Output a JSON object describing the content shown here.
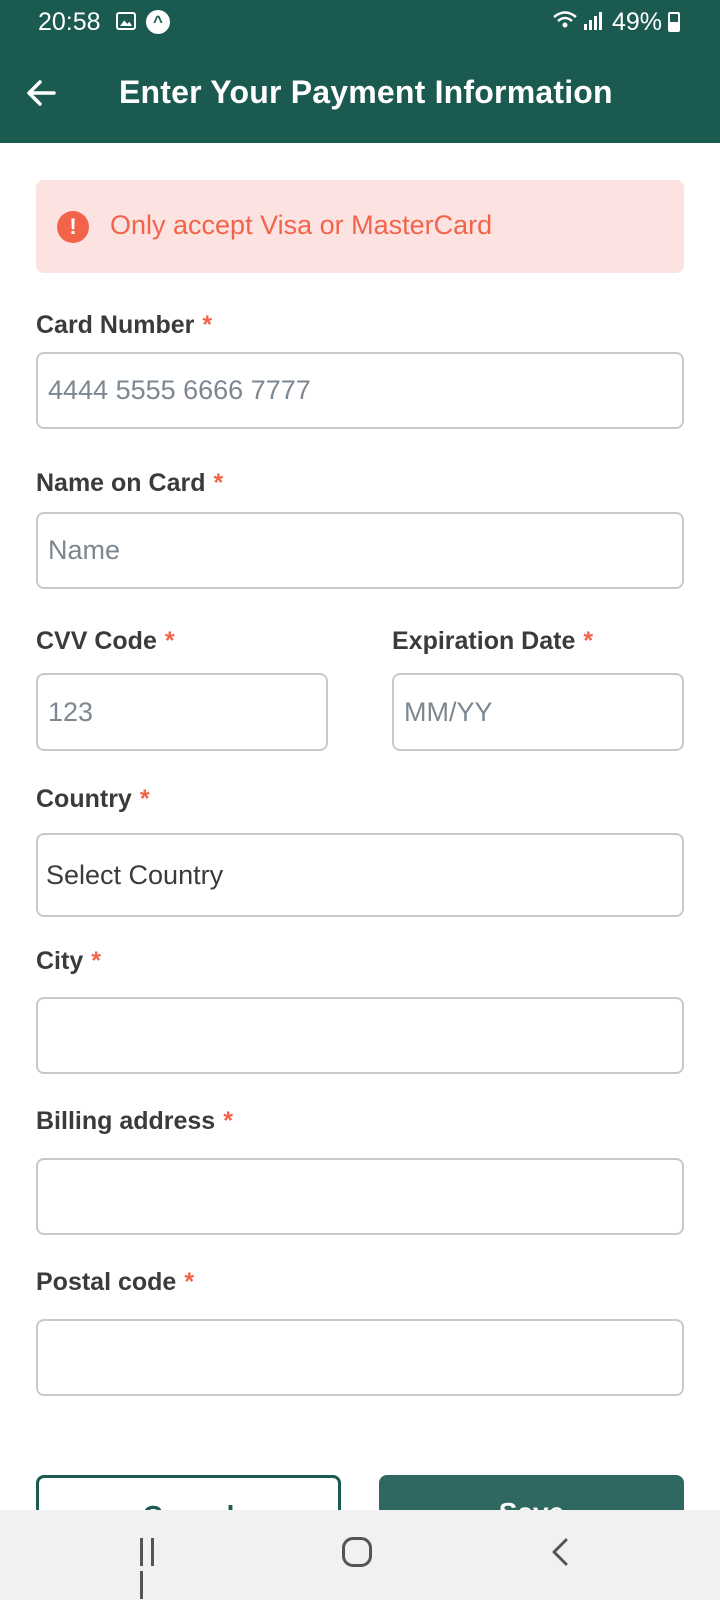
{
  "status": {
    "time": "20:58",
    "battery": "49%",
    "icons": [
      "gallery-icon",
      "app-icon",
      "wifi-icon",
      "signal-icon",
      "battery-icon"
    ]
  },
  "header": {
    "title": "Enter Your Payment Information",
    "back_icon": "arrow-left-icon"
  },
  "alert": {
    "text": "Only accept Visa or MasterCard",
    "icon": "exclamation-circle-icon"
  },
  "form": {
    "required_mark": "*",
    "card_number": {
      "label": "Card Number",
      "placeholder": "4444 5555 6666 7777"
    },
    "name_on_card": {
      "label": "Name on Card",
      "placeholder": "Name"
    },
    "cvv": {
      "label": "CVV Code",
      "placeholder": "123"
    },
    "expiration": {
      "label": "Expiration Date",
      "placeholder": "MM/YY"
    },
    "country": {
      "label": "Country",
      "value": "Select Country"
    },
    "city": {
      "label": "City",
      "value": ""
    },
    "billing_address": {
      "label": "Billing address",
      "value": ""
    },
    "postal_code": {
      "label": "Postal code",
      "value": ""
    }
  },
  "actions": {
    "cancel_label": "Cancel",
    "save_label": "Save"
  },
  "colors": {
    "primary": "#1b5a50",
    "accent": "#f2644a",
    "alert_bg": "#fde2e2"
  }
}
